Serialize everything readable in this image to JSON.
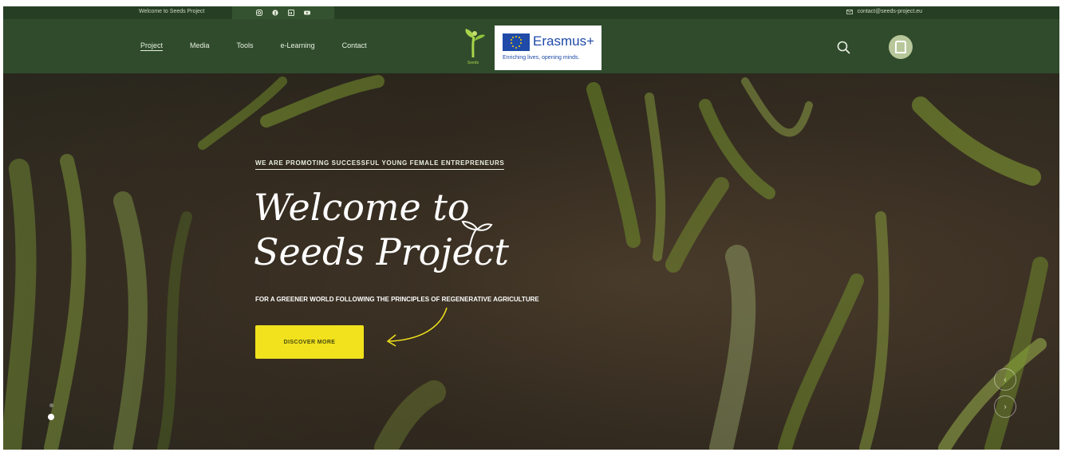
{
  "topbar": {
    "welcome": "Welcome to Seeds Project",
    "email": "contact@seeds-project.eu",
    "social_icons": [
      "instagram-icon",
      "facebook-icon",
      "linkedin-icon",
      "youtube-icon"
    ]
  },
  "nav": {
    "items": [
      {
        "label": "Project",
        "active": true
      },
      {
        "label": "Media"
      },
      {
        "label": "Tools"
      },
      {
        "label": "e-Learning"
      },
      {
        "label": "Contact"
      }
    ],
    "logo_text": "Seeds"
  },
  "erasmus": {
    "name": "Erasmus+",
    "tagline": "Enriching lives, opening minds."
  },
  "hero": {
    "tagline": "WE ARE PROMOTING SUCCESSFUL YOUNG FEMALE ENTREPRENEURS",
    "title_line1": "Welcome to",
    "title_line2": "Seeds Project",
    "subtitle": "FOR A GREENER WORLD FOLLOWING THE PRINCIPLES OF REGENERATIVE AGRICULTURE",
    "cta": "DISCOVER MORE"
  },
  "colors": {
    "nav_bg": "#2f4b2c",
    "cta": "#f1e21d",
    "accent_green": "#a7d44a"
  }
}
